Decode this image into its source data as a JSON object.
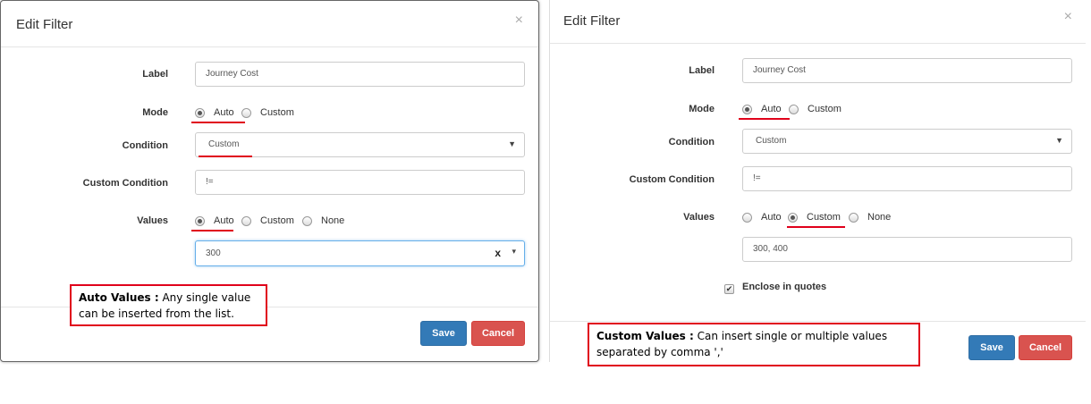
{
  "left": {
    "title": "Edit Filter",
    "close": "×",
    "labels": {
      "label": "Label",
      "mode": "Mode",
      "condition": "Condition",
      "custom_condition": "Custom Condition",
      "values": "Values"
    },
    "label_value": "Journey Cost",
    "mode_options": [
      "Auto",
      "Custom"
    ],
    "mode_selected": "Auto",
    "condition_value": "Custom",
    "custom_condition_value": "!=",
    "values_options": [
      "Auto",
      "Custom",
      "None"
    ],
    "values_selected": "Auto",
    "values_select_value": "300",
    "clear_glyph": "x",
    "note_bold": "Auto Values :",
    "note_text": " Any single value can be inserted from the list.",
    "save": "Save",
    "cancel": "Cancel"
  },
  "right": {
    "title": "Edit Filter",
    "close": "×",
    "labels": {
      "label": "Label",
      "mode": "Mode",
      "condition": "Condition",
      "custom_condition": "Custom Condition",
      "values": "Values"
    },
    "label_value": "Journey Cost",
    "mode_options": [
      "Auto",
      "Custom"
    ],
    "mode_selected": "Auto",
    "condition_value": "Custom",
    "custom_condition_value": "!=",
    "values_options": [
      "Auto",
      "Custom",
      "None"
    ],
    "values_selected": "Custom",
    "values_input_value": "300, 400",
    "enclose_label": "Enclose in quotes",
    "enclose_checked": true,
    "note_bold": "Custom Values :",
    "note_text": " Can insert single or multiple values separated by comma ','",
    "save": "Save",
    "cancel": "Cancel"
  },
  "icons": {
    "dropdown": "caret-down-icon",
    "checkmark": "check-icon",
    "close": "close-icon"
  },
  "colors": {
    "highlight": "#e0001b",
    "save": "#337ab7",
    "cancel": "#d9534f"
  }
}
